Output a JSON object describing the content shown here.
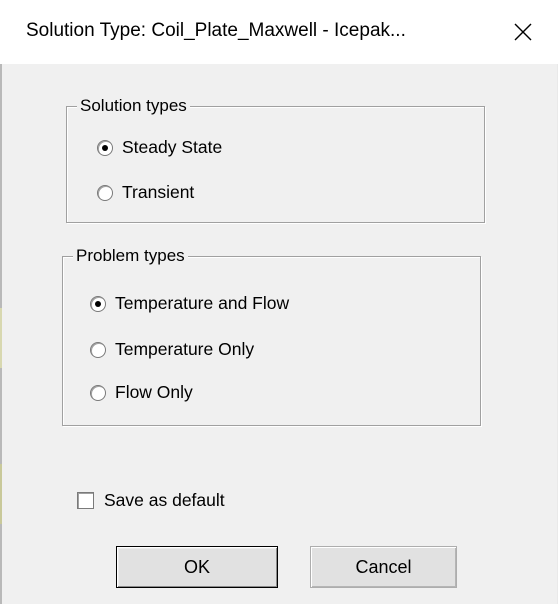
{
  "window": {
    "title": "Solution Type: Coil_Plate_Maxwell - Icepak...",
    "close_icon": "close-x-icon"
  },
  "solution_types": {
    "legend": "Solution types",
    "options": [
      {
        "label": "Steady State",
        "checked": true
      },
      {
        "label": "Transient",
        "checked": false
      }
    ]
  },
  "problem_types": {
    "legend": "Problem types",
    "options": [
      {
        "label": "Temperature and Flow",
        "checked": true
      },
      {
        "label": "Temperature Only",
        "checked": false
      },
      {
        "label": "Flow Only",
        "checked": false
      }
    ]
  },
  "save_default": {
    "label": "Save as default",
    "checked": false
  },
  "buttons": {
    "ok_label": "OK",
    "cancel_label": "Cancel"
  }
}
